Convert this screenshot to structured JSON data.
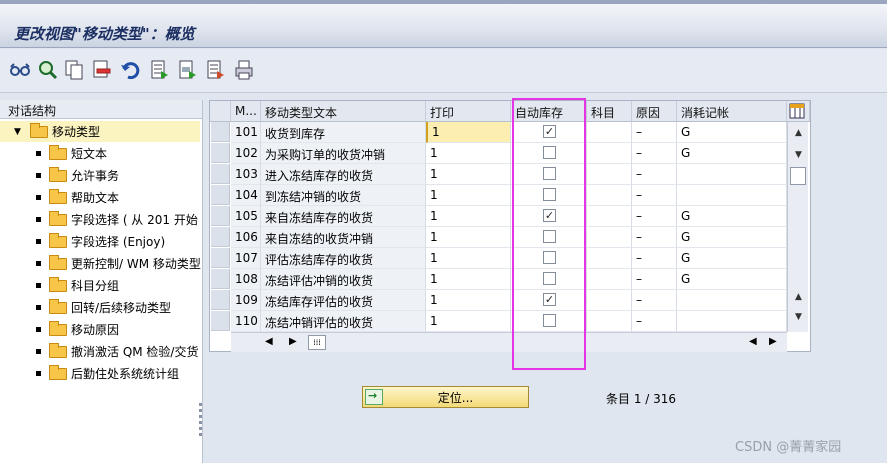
{
  "window": {
    "title": "更改视图\"移动类型\"：概览"
  },
  "toolbar": {
    "icons": [
      "glasses-icon",
      "find-icon",
      "copy-icon",
      "delete-icon",
      "undo-icon",
      "select-all-icon",
      "select-block-icon",
      "deselect-icon",
      "print-icon"
    ]
  },
  "tree": {
    "header": "对话结构",
    "root": "移动类型",
    "items": [
      "短文本",
      "允许事务",
      "帮助文本",
      "字段选择 ( 从 201 开始",
      "字段选择 (Enjoy)",
      "更新控制/ WM 移动类型",
      "科目分组",
      "回转/后续移动类型",
      "移动原因",
      "撤消激活 QM 检验/交货",
      "后勤住处系统统计组"
    ]
  },
  "table": {
    "columns": [
      "M...",
      "移动类型文本",
      "打印",
      "自动库存",
      "科目",
      "原因",
      "消耗记帐"
    ],
    "rows": [
      {
        "m": "101",
        "text": "收货到库存",
        "print": "1",
        "auto": true,
        "acct": "",
        "reason": "–",
        "consume": "G"
      },
      {
        "m": "102",
        "text": "为采购订单的收货冲销",
        "print": "1",
        "auto": false,
        "acct": "",
        "reason": "–",
        "consume": "G"
      },
      {
        "m": "103",
        "text": "进入冻结库存的收货",
        "print": "1",
        "auto": false,
        "acct": "",
        "reason": "–",
        "consume": ""
      },
      {
        "m": "104",
        "text": "到冻结冲销的收货",
        "print": "1",
        "auto": false,
        "acct": "",
        "reason": "–",
        "consume": ""
      },
      {
        "m": "105",
        "text": "来自冻结库存的收货",
        "print": "1",
        "auto": true,
        "acct": "",
        "reason": "–",
        "consume": "G"
      },
      {
        "m": "106",
        "text": "来自冻结的收货冲销",
        "print": "1",
        "auto": false,
        "acct": "",
        "reason": "–",
        "consume": "G"
      },
      {
        "m": "107",
        "text": "评估冻结库存的收货",
        "print": "1",
        "auto": false,
        "acct": "",
        "reason": "–",
        "consume": "G"
      },
      {
        "m": "108",
        "text": "冻结评估冲销的收货",
        "print": "1",
        "auto": false,
        "acct": "",
        "reason": "–",
        "consume": "G"
      },
      {
        "m": "109",
        "text": "冻结库存评估的收货",
        "print": "1",
        "auto": true,
        "acct": "",
        "reason": "–",
        "consume": ""
      },
      {
        "m": "110",
        "text": "冻结冲销评估的收货",
        "print": "1",
        "auto": false,
        "acct": "",
        "reason": "–",
        "consume": ""
      }
    ]
  },
  "footer": {
    "position_button": "定位...",
    "entry_label": "条目 1 / 316"
  },
  "watermark": "CSDN @菁菁家园",
  "colors": {
    "highlight": "#e536e5",
    "focus": "#fbeeb0"
  }
}
